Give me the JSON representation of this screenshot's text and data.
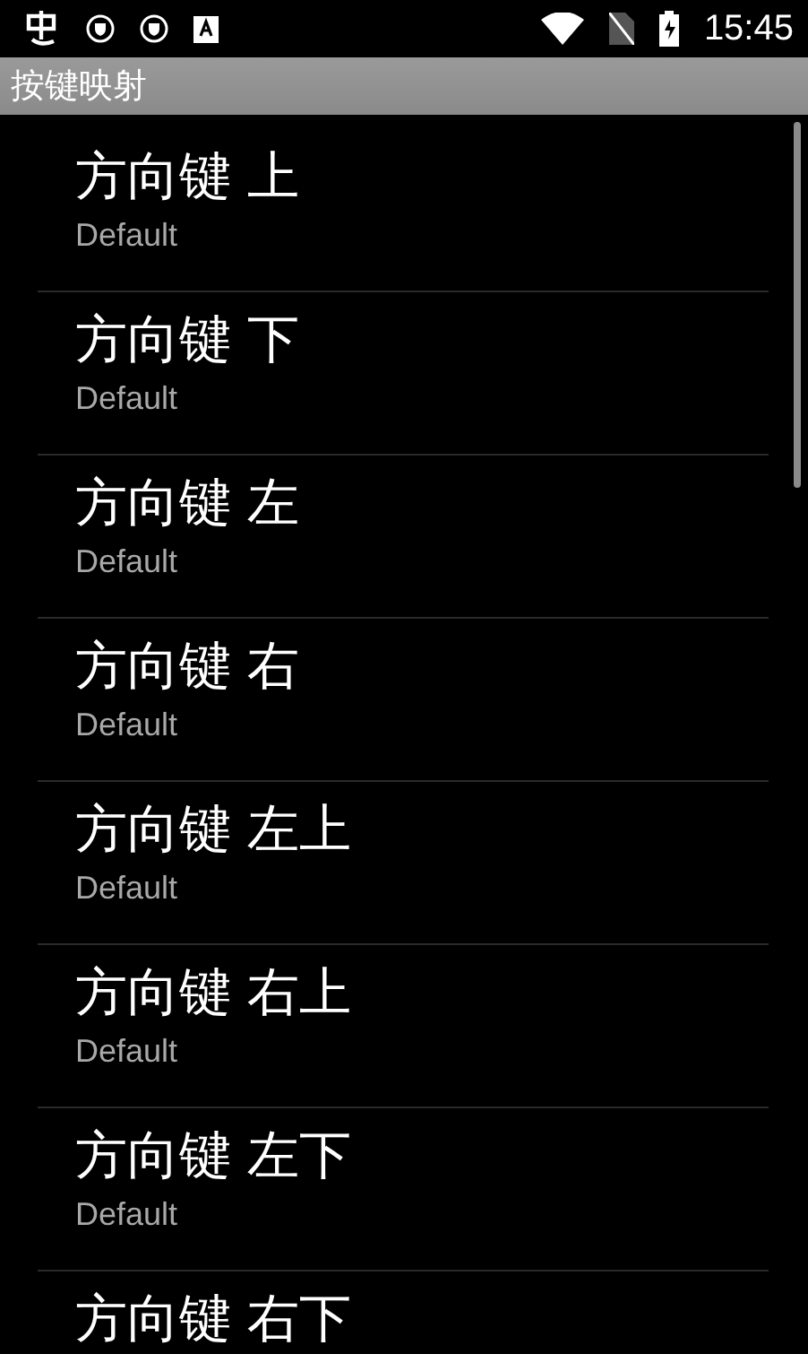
{
  "status_bar": {
    "time": "15:45"
  },
  "title_bar": {
    "title": "按键映射"
  },
  "items": [
    {
      "title": "方向键 上",
      "summary": "Default"
    },
    {
      "title": "方向键 下",
      "summary": "Default"
    },
    {
      "title": "方向键 左",
      "summary": "Default"
    },
    {
      "title": "方向键 右",
      "summary": "Default"
    },
    {
      "title": "方向键 左上",
      "summary": "Default"
    },
    {
      "title": "方向键 右上",
      "summary": "Default"
    },
    {
      "title": "方向键 左下",
      "summary": "Default"
    },
    {
      "title": "方向键 右下"
    }
  ]
}
